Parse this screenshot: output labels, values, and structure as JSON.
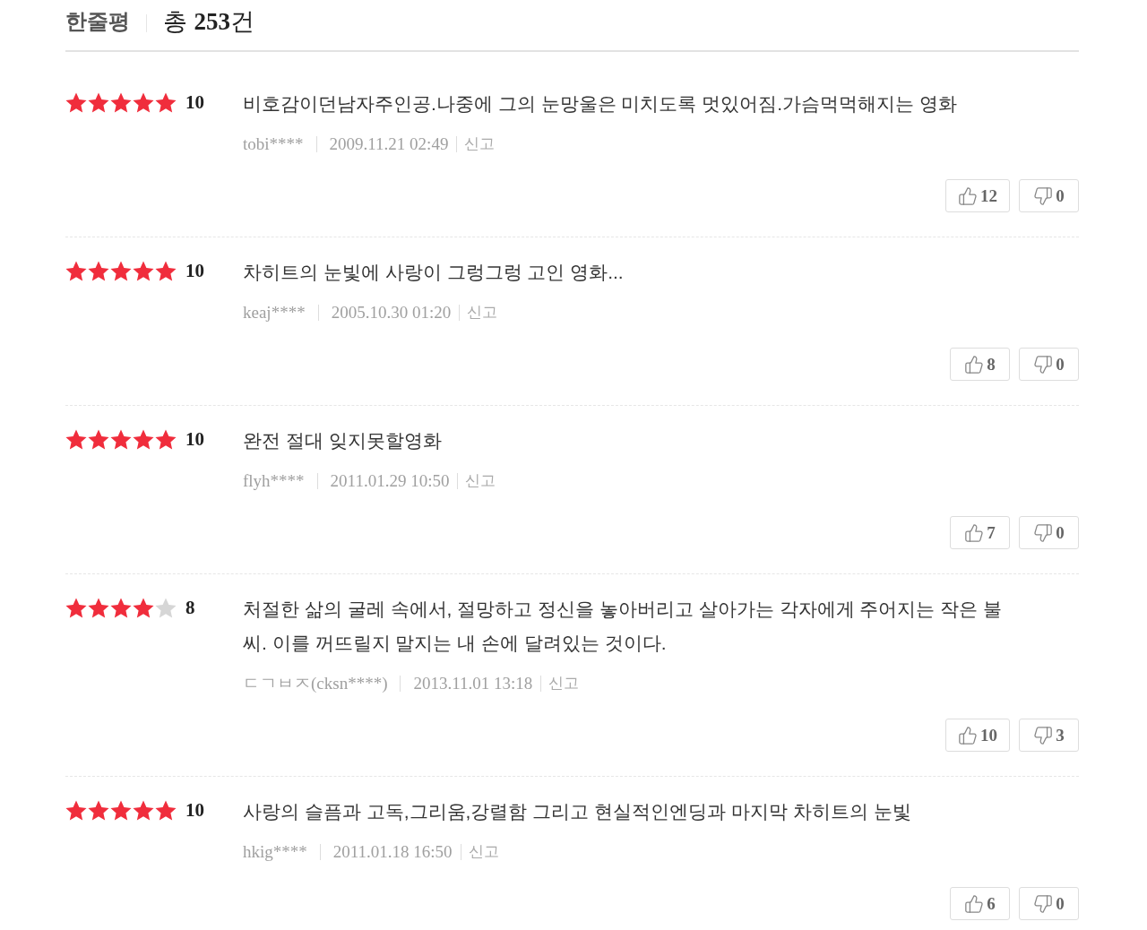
{
  "header": {
    "title": "한줄평",
    "total": "총 **253**건"
  },
  "reviews": [
    {
      "stars": 5,
      "score": "10",
      "text": "비호감이던남자주인공.나중에 그의 눈망울은 미치도록 멋있어짐.가슴먹먹해지는 영화",
      "author": "tobi****",
      "date": "2009.11.21 02:49",
      "report": "신고",
      "likes": "12",
      "dislikes": "0"
    },
    {
      "stars": 5,
      "score": "10",
      "text": "차히트의 눈빛에 사랑이 그렁그렁 고인 영화...",
      "author": "keaj****",
      "date": "2005.10.30 01:20",
      "report": "신고",
      "likes": "8",
      "dislikes": "0"
    },
    {
      "stars": 5,
      "score": "10",
      "text": "완전 절대 잊지못할영화",
      "author": "flyh****",
      "date": "2011.01.29 10:50",
      "report": "신고",
      "likes": "7",
      "dislikes": "0"
    },
    {
      "stars": 4,
      "score": "8",
      "text": "처절한 삶의 굴레 속에서, 절망하고 정신을 놓아버리고 살아가는 각자에게 주어지는 작은 불씨. 이를 꺼뜨릴지 말지는 내 손에 달려있는 것이다.",
      "author": "ㄷㄱㅂㅈ(cksn****)",
      "date": "2013.11.01 13:18",
      "report": "신고",
      "likes": "10",
      "dislikes": "3"
    },
    {
      "stars": 5,
      "score": "10",
      "text": "사랑의 슬픔과 고독,그리움,강렬함 그리고 현실적인엔딩과 마지막 차히트의 눈빛",
      "author": "hkig****",
      "date": "2011.01.18 16:50",
      "report": "신고",
      "likes": "6",
      "dislikes": "0"
    }
  ]
}
